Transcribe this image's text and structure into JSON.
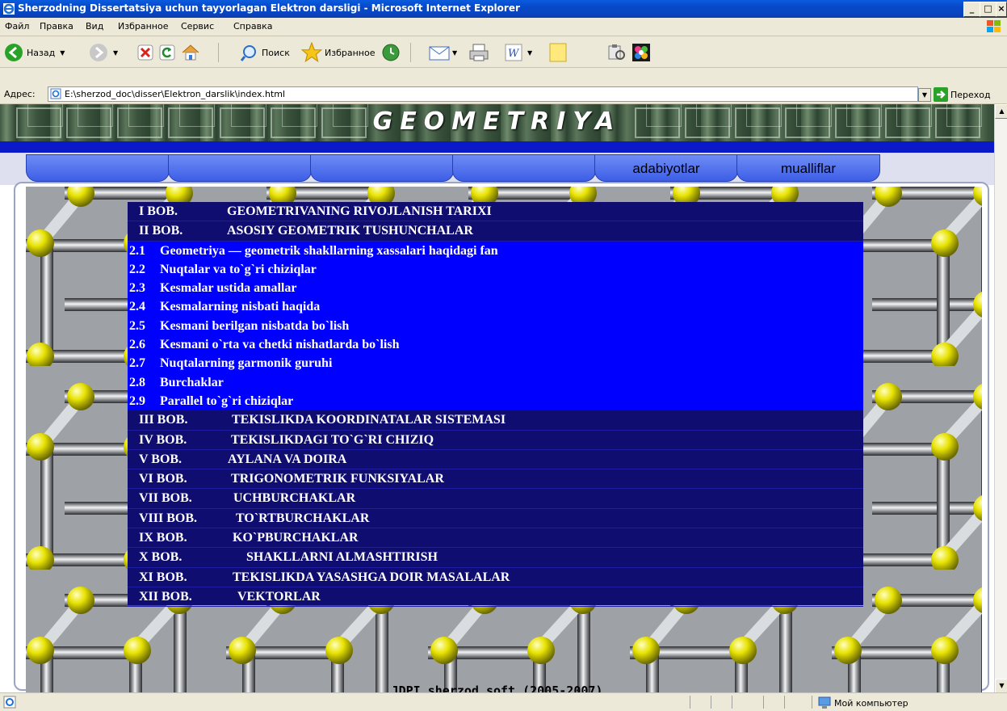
{
  "window": {
    "title": "Sherzodning Dissertatsiya uchun tayyorlagan Elektron darsligi - Microsoft Internet Explorer",
    "controls": [
      "_",
      "□",
      "×"
    ]
  },
  "menu": {
    "items": [
      "Файл",
      "Правка",
      "Вид",
      "Избранное",
      "Сервис",
      "Справка"
    ]
  },
  "toolbar": {
    "back_label": "Назад",
    "search_label": "Поиск",
    "favorites_label": "Избранное"
  },
  "address": {
    "label": "Адрес:",
    "url": "E:\\sherzod_doc\\disser\\Elektron_darslik\\index.html",
    "go_label": "Переход"
  },
  "page": {
    "banner_title": "GEOMETRIYA",
    "tabs": [
      "",
      "",
      "",
      "",
      "adabiyotlar",
      "mualliflar"
    ],
    "footer": "JDPI sherzod soft (2005-2007)",
    "chapters_before": [
      {
        "num": "I BOB.",
        "title": "GEOMETRIVANING RIVOJLANISH TARIXI"
      },
      {
        "num": "II BOB.",
        "title": "ASOSIY GEOMETRIK TUSHUNCHALAR"
      }
    ],
    "subsections": [
      {
        "num": "2.1",
        "title": "Geometriya — geometrik shakllarning xassalari haqidagi fan"
      },
      {
        "num": "2.2",
        "title": "Nuqtalar va to`g`ri chiziqlar"
      },
      {
        "num": "2.3",
        "title": "Kesmalar ustida amallar"
      },
      {
        "num": "2.4",
        "title": "Kesmalarning nisbati haqida"
      },
      {
        "num": "2.5",
        "title": "Kesmani berilgan nisbatda bo`lish"
      },
      {
        "num": "2.6",
        "title": "Kesmani o`rta va chetki nishatlarda bo`lish"
      },
      {
        "num": "2.7",
        "title": "Nuqtalarning garmonik guruhi"
      },
      {
        "num": "2.8",
        "title": "Burchaklar"
      },
      {
        "num": "2.9",
        "title": "Parallel to`g`ri chiziqlar"
      }
    ],
    "chapters_after": [
      {
        "num": "III BOB.",
        "title": "TEKISLIKDA KOORDINATALAR SISTEMASI"
      },
      {
        "num": "IV BOB.",
        "title": "TEKISLIKDAGI TO`G`RI CHIZIQ"
      },
      {
        "num": "V BOB.",
        "title": "AYLANA VA DOIRA"
      },
      {
        "num": "VI BOB.",
        "title": "TRIGONOMETRIK FUNKSIYALAR"
      },
      {
        "num": "VII BOB.",
        "title": "UCHBURCHAKLAR"
      },
      {
        "num": "VIII BOB.",
        "title": "TO`RTBURCHAKLAR"
      },
      {
        "num": "IX BOB.",
        "title": "KO`PBURCHAKLAR"
      },
      {
        "num": "X BOB.",
        "title": "SHAKLLARNI ALMASHTIRISH"
      },
      {
        "num": "XI BOB.",
        "title": "TEKISLIKDA YASASHGA DOIR MASALALAR"
      },
      {
        "num": "XII BOB.",
        "title": "VEKTORLAR"
      }
    ]
  },
  "status": {
    "zone": "Мой компьютер"
  },
  "colors": {
    "menu_bg": "#0f0d70",
    "sub_bg": "#0000ff",
    "tab_blue": "#3d5ee6"
  }
}
